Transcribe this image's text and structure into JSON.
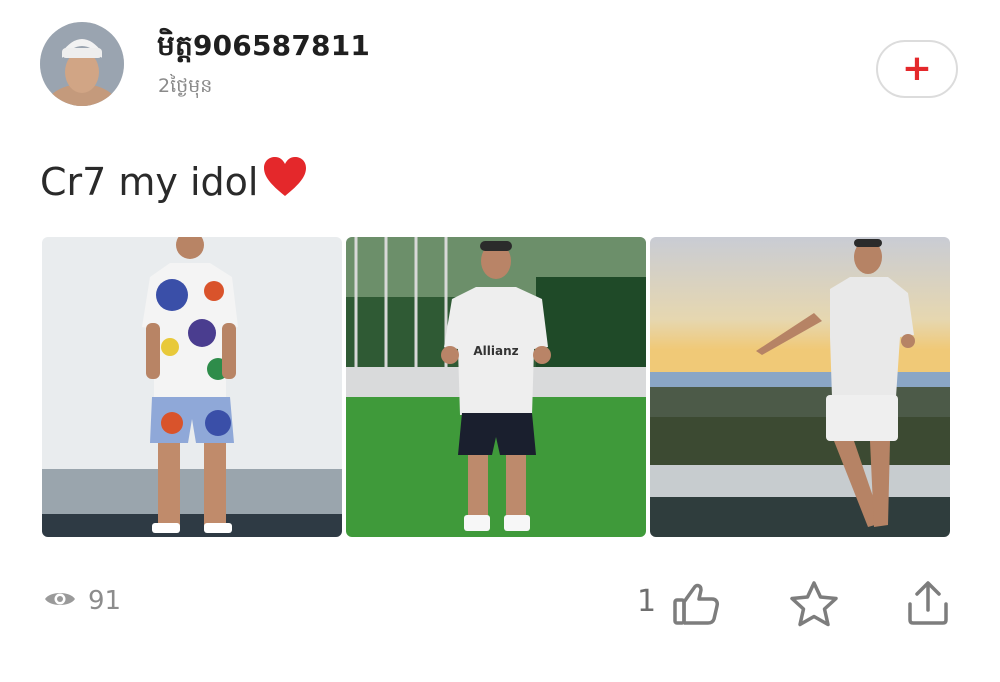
{
  "post": {
    "username": "មិត្ត906587811",
    "time_ago": "2ថ្ងៃមុន",
    "follow_label": "+",
    "caption": "Cr7 my idol"
  },
  "photos": [
    {
      "name": "photo-floral-outfit"
    },
    {
      "name": "photo-juventus-training-kit"
    },
    {
      "name": "photo-white-outfit-sunset"
    }
  ],
  "stats": {
    "views": "91",
    "likes": "1"
  },
  "colors": {
    "accent": "#e4282b",
    "icon_gray": "#7d7d7d",
    "text_dark": "#1f1f1f"
  },
  "icons": {
    "views": "eye-icon",
    "like": "thumbs-up-icon",
    "favorite": "star-icon",
    "share": "share-icon",
    "heart": "heart-emoji"
  }
}
